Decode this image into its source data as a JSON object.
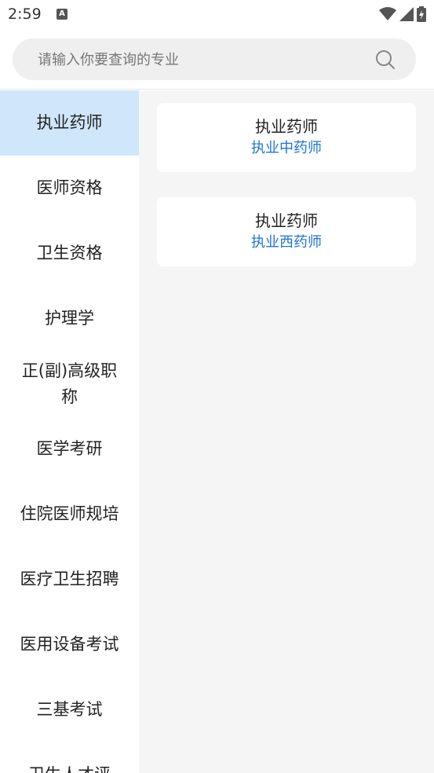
{
  "status_bar": {
    "time": "2:59",
    "notification_glyph": "A",
    "icons": [
      "wifi-icon",
      "signal-icon",
      "battery-icon"
    ]
  },
  "search": {
    "placeholder": "请输入你要查询的专业",
    "value": "",
    "icon": "search-icon"
  },
  "sidebar": {
    "active_index": 0,
    "items": [
      {
        "label": "执业药师"
      },
      {
        "label": "医师资格"
      },
      {
        "label": "卫生资格"
      },
      {
        "label": "护理学"
      },
      {
        "label": "正(副)高级职称"
      },
      {
        "label": "医学考研"
      },
      {
        "label": "住院医师规培"
      },
      {
        "label": "医疗卫生招聘"
      },
      {
        "label": "医用设备考试"
      },
      {
        "label": "三基考试"
      },
      {
        "label": "卫生人才评"
      }
    ]
  },
  "content": {
    "cards": [
      {
        "title": "执业药师",
        "subtitle": "执业中药师"
      },
      {
        "title": "执业药师",
        "subtitle": "执业西药师"
      }
    ]
  },
  "colors": {
    "active_item_bg": "#cfe6fb",
    "link_blue": "#1e74d6",
    "content_bg": "#f5f5f5",
    "search_bg": "#efefef"
  }
}
